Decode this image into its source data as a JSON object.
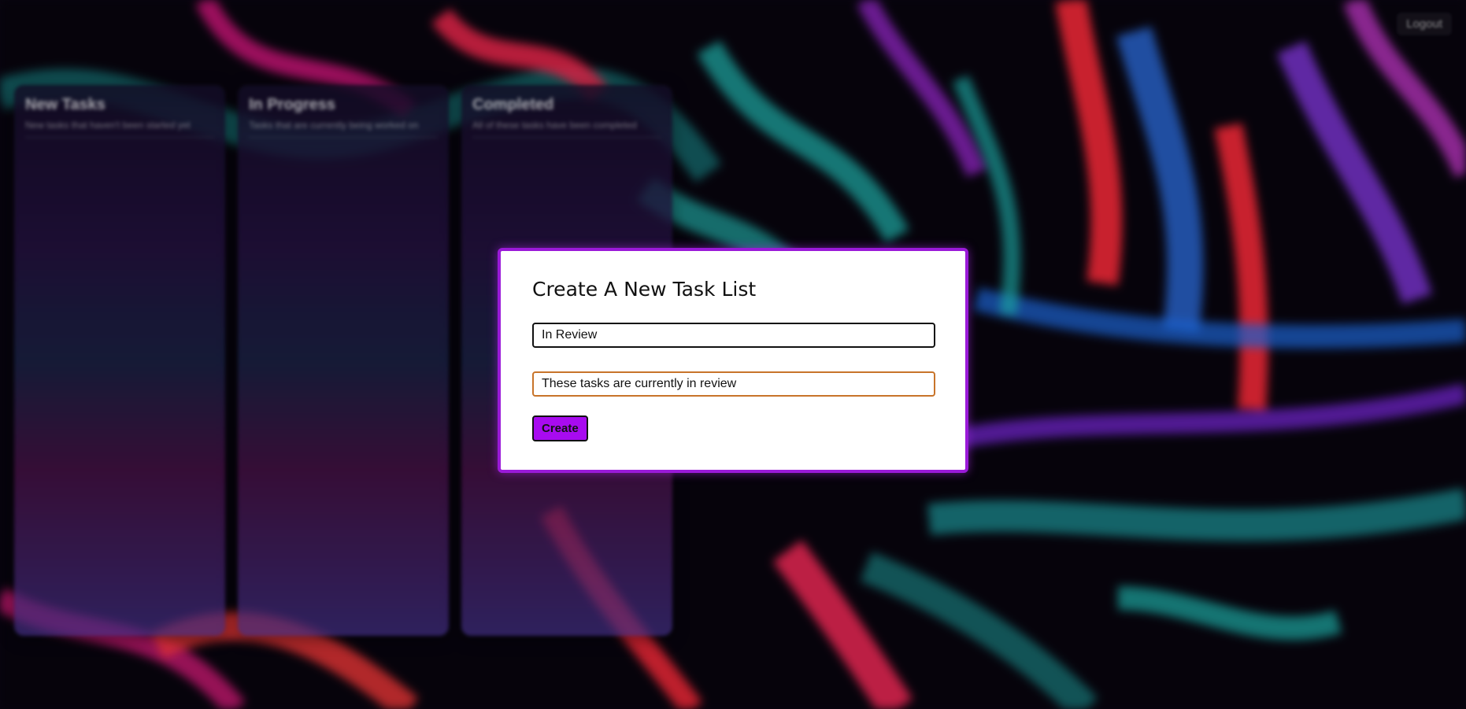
{
  "header": {
    "logout_label": "Logout"
  },
  "board": {
    "columns": [
      {
        "title": "New Tasks",
        "description": "New tasks that haven't been started yet"
      },
      {
        "title": "In Progress",
        "description": "Tasks that are currently being worked on"
      },
      {
        "title": "Completed",
        "description": "All of these tasks have been completed"
      }
    ]
  },
  "modal": {
    "title": "Create A New Task List",
    "name_value": "In Review",
    "description_value": "These tasks are currently in review",
    "create_label": "Create"
  },
  "colors": {
    "accent": "#a80bf0",
    "modal_border": "#9a1ad8",
    "focus_border": "#c8742a"
  }
}
